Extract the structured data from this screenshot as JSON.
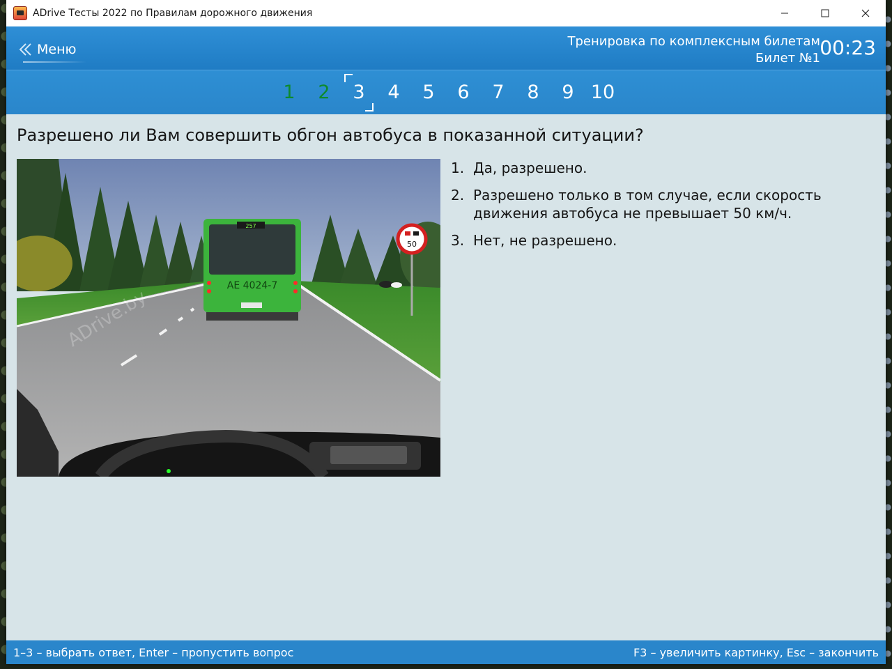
{
  "window": {
    "title": "ADrive Тесты 2022 по Правилам дорожного движения",
    "controls": {
      "minimize": "—",
      "maximize": "☐",
      "close": "✕"
    }
  },
  "header": {
    "menu_label": "Меню",
    "mode": "Тренировка по комплексным билетам",
    "ticket": "Билет №1",
    "timer": "00:23"
  },
  "question_nav": [
    {
      "label": "1",
      "state": "done"
    },
    {
      "label": "2",
      "state": "done"
    },
    {
      "label": "3",
      "state": "current"
    },
    {
      "label": "4",
      "state": "pending"
    },
    {
      "label": "5",
      "state": "pending"
    },
    {
      "label": "6",
      "state": "pending"
    },
    {
      "label": "7",
      "state": "pending"
    },
    {
      "label": "8",
      "state": "pending"
    },
    {
      "label": "9",
      "state": "pending"
    },
    {
      "label": "10",
      "state": "pending"
    }
  ],
  "question": {
    "text": "Разрешено ли Вам совершить обгон автобуса в показанной ситуации?",
    "answers": [
      {
        "num": "1.",
        "text": "Да, разрешено."
      },
      {
        "num": "2.",
        "text": "Разрешено только в том случае, если скорость движения автобуса не превышает 50 км/ч."
      },
      {
        "num": "3.",
        "text": "Нет, не разрешено."
      }
    ]
  },
  "scene": {
    "bus_route": "257",
    "bus_plate": "AE 4024-7",
    "sign_value": "50",
    "watermark": "ADrive.by"
  },
  "footer": {
    "left": "1–3 – выбрать ответ, Enter – пропустить вопрос",
    "right": "F3 – увеличить картинку, Esc – закончить"
  },
  "colors": {
    "accent": "#2a86cb",
    "done": "#0e8a2e",
    "bus": "#3cb43c"
  }
}
